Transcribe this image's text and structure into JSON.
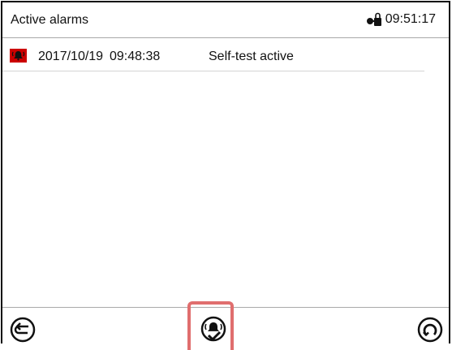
{
  "header": {
    "title": "Active alarms",
    "time": "09:51:17",
    "lock_icon": "lock-icon"
  },
  "alarms": [
    {
      "date": "2017/10/19",
      "time": "09:48:38",
      "text": "Self-test active",
      "icon": "alarm-bell-icon"
    }
  ],
  "footer": {
    "back_icon": "back-arrow-icon",
    "acknowledge_icon": "alarm-acknowledge-icon",
    "refresh_icon": "refresh-icon"
  },
  "colors": {
    "alarm_icon_bg": "#cc0000",
    "highlight": "#e06e6e",
    "frame": "#111111"
  }
}
